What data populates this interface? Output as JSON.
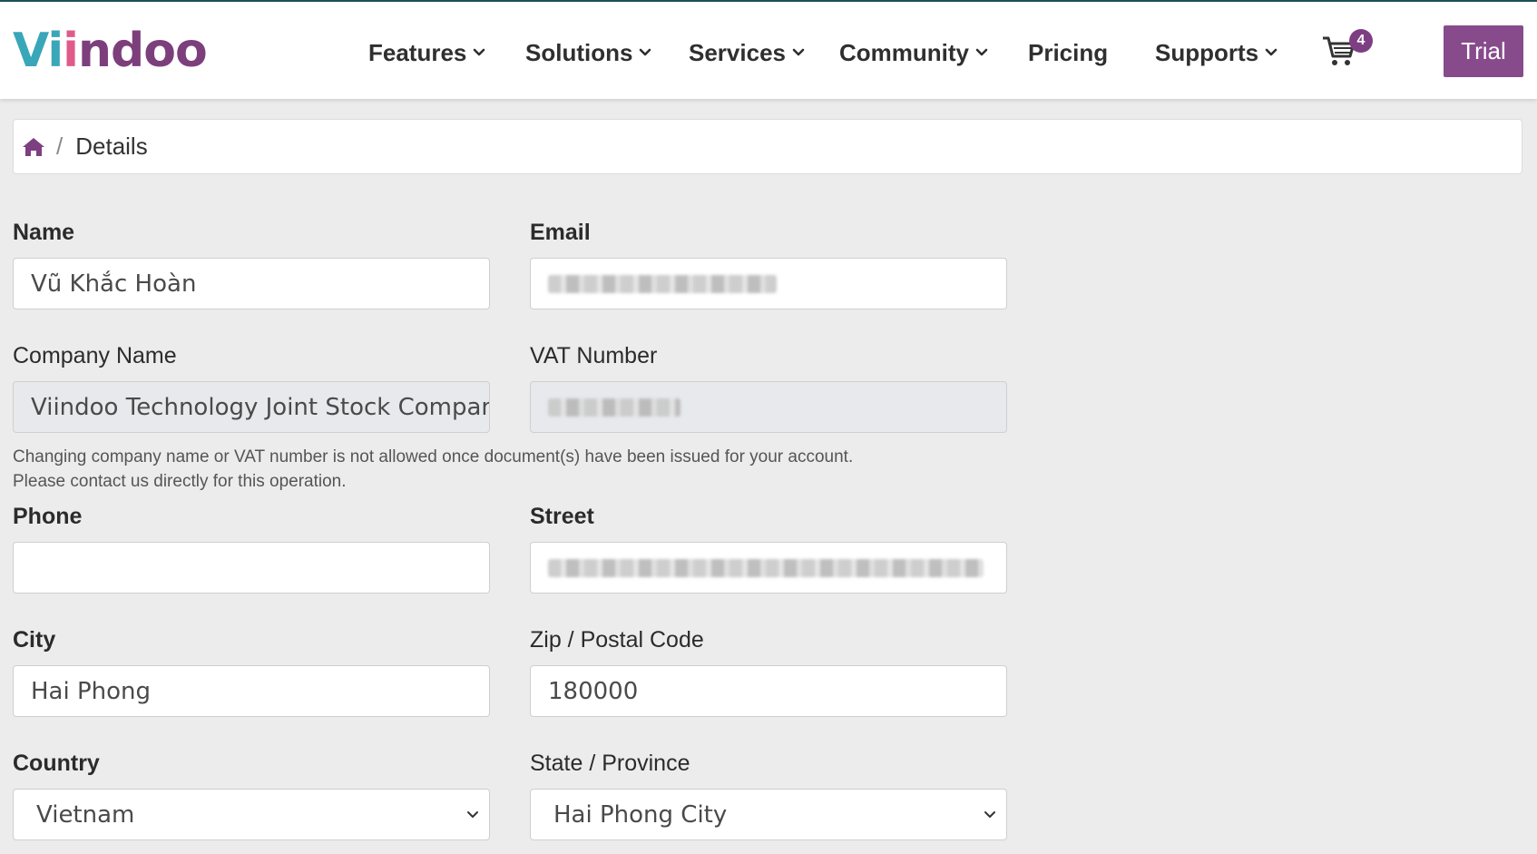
{
  "header": {
    "logo": "Viindoo",
    "nav": [
      {
        "label": "Features",
        "has_dropdown": true
      },
      {
        "label": "Solutions",
        "has_dropdown": true
      },
      {
        "label": "Services",
        "has_dropdown": true
      },
      {
        "label": "Community",
        "has_dropdown": true
      },
      {
        "label": "Pricing",
        "has_dropdown": false
      },
      {
        "label": "Supports",
        "has_dropdown": true
      }
    ],
    "cart_icon": "cart-icon",
    "cart_count": "4",
    "trial_label": "Trial",
    "accent_color": "#874b8c"
  },
  "breadcrumb": {
    "home_icon": "home-icon",
    "separator": "/",
    "current": "Details"
  },
  "form": {
    "name": {
      "label": "Name",
      "value": "Vũ Khắc Hoàn"
    },
    "email": {
      "label": "Email",
      "value": ""
    },
    "company_name": {
      "label": "Company Name",
      "value": "Viindoo Technology Joint Stock Company"
    },
    "vat_number": {
      "label": "VAT Number",
      "value": ""
    },
    "help_line1": "Changing company name or VAT number is not allowed once document(s) have been issued for your account.",
    "help_line2": "Please contact us directly for this operation.",
    "phone": {
      "label": "Phone",
      "value": ""
    },
    "street": {
      "label": "Street",
      "value": ""
    },
    "city": {
      "label": "City",
      "value": "Hai Phong"
    },
    "zip": {
      "label": "Zip / Postal Code",
      "value": "180000"
    },
    "country": {
      "label": "Country",
      "value": "Vietnam"
    },
    "state": {
      "label": "State / Province",
      "value": "Hai Phong City"
    }
  }
}
